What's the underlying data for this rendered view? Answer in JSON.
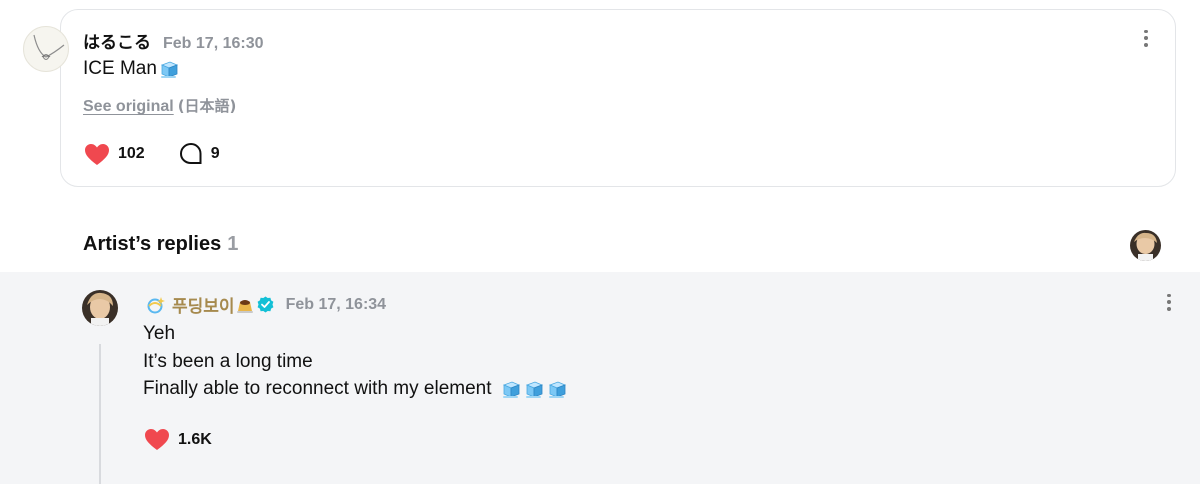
{
  "post": {
    "username": "はるこる",
    "timestamp": "Feb 17, 16:30",
    "body": "ICE Man",
    "see_original": "See original",
    "language": "(日本語)",
    "likes": "102",
    "comments": "9",
    "icons": [
      "ice-cube-icon",
      "heart-icon",
      "comment-bubble-icon",
      "more-options-icon"
    ]
  },
  "replies_section": {
    "title": "Artist’s replies",
    "count": "1"
  },
  "reply": {
    "name": "푸딩보이",
    "timestamp": "Feb 17, 16:34",
    "lines": [
      "Yeh",
      "It’s been a long time",
      "Finally able to reconnect with my element"
    ],
    "likes": "1.6K",
    "icons": [
      "sparkle-icon",
      "pudding-icon",
      "verified-badge-icon",
      "ice-cube-icon",
      "heart-icon",
      "more-options-icon"
    ]
  },
  "colors": {
    "heart": "#f0484f",
    "artist_name": "#a68a4e",
    "verified": "#13c0d6",
    "muted": "#8f939a",
    "reply_bg": "#f4f5f7"
  }
}
